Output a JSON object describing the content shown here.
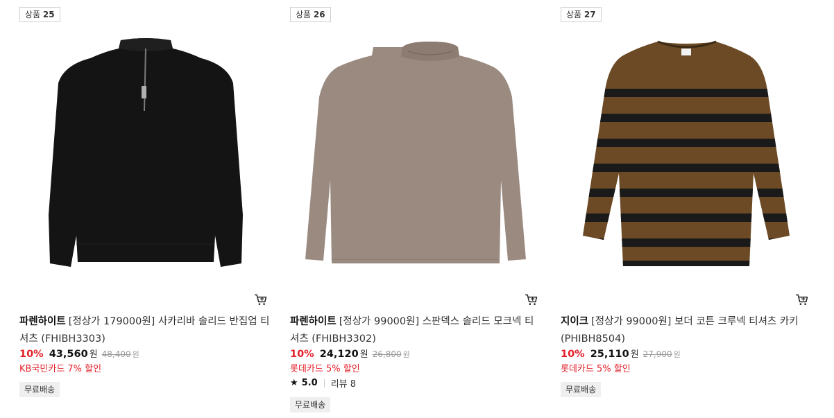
{
  "products": [
    {
      "badge_label": "상품",
      "badge_num": "25",
      "brand": "파렌하이트",
      "name": "[정상가 179000원] 사카리바 솔리드 반집업 티셔츠 (FHIBH3303)",
      "discount": "10%",
      "price": "43,560",
      "currency": "원",
      "original_price": "48,400",
      "original_currency": "원",
      "card_benefit": "KB국민카드 7% 할인",
      "shipping": "무료배송",
      "image_icon": "black-half-zip-sweater-image",
      "garment_color": "#111111"
    },
    {
      "badge_label": "상품",
      "badge_num": "26",
      "brand": "파렌하이트",
      "name": "[정상가 99000원] 스판덱스 솔리드 모크넥 티셔츠 (FHIBH3302)",
      "discount": "10%",
      "price": "24,120",
      "currency": "원",
      "original_price": "26,800",
      "original_currency": "원",
      "card_benefit": "롯데카드 5% 할인",
      "rating": "5.0",
      "review_label": "리뷰 8",
      "shipping": "무료배송",
      "image_icon": "taupe-mockneck-tshirt-image",
      "garment_color": "#9b8a80"
    },
    {
      "badge_label": "상품",
      "badge_num": "27",
      "brand": "지이크",
      "name": "[정상가 99000원] 보더 코튼 크루넥 티셔츠 카키 (PHIBH8504)",
      "discount": "10%",
      "price": "25,110",
      "currency": "원",
      "original_price": "27,900",
      "original_currency": "원",
      "card_benefit": "롯데카드 5% 할인",
      "shipping": "무료배송",
      "image_icon": "striped-crewneck-tshirt-image",
      "garment_color": "#6b4a25"
    }
  ]
}
